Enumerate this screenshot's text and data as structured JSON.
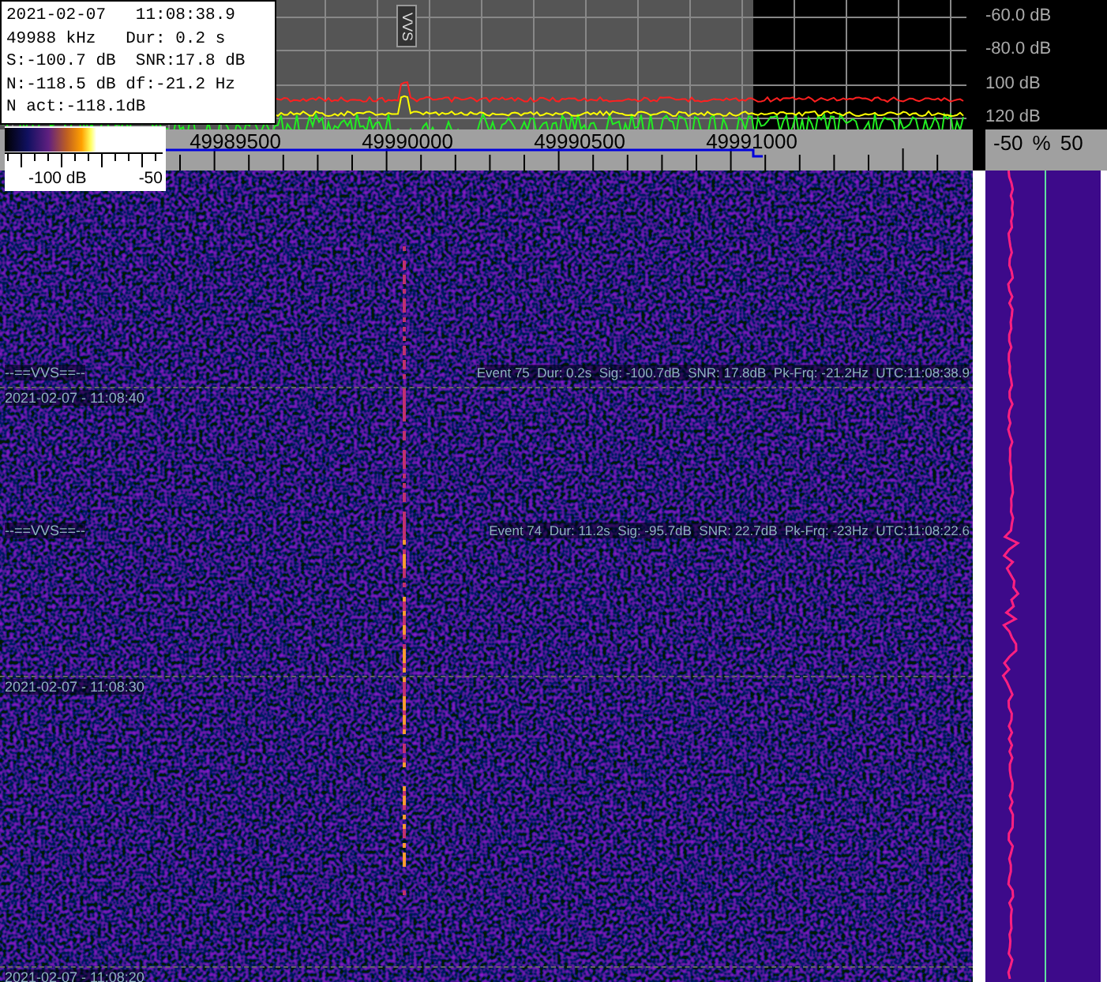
{
  "info_box": {
    "lines": [
      "2021-02-07   11:08:38.9",
      "49988 kHz   Dur: 0.2 s",
      "S:-100.7 dB  SNR:17.8 dB",
      "N:-118.5 dB df:-21.2 Hz",
      "N act:-118.1dB"
    ]
  },
  "spectrum": {
    "marker_label": "VVS",
    "db_labels": [
      "-60.0 dB",
      "-80.0 dB",
      "100 dB",
      "120 dB"
    ]
  },
  "color_scale": {
    "labels": [
      "-100 dB",
      "-50"
    ]
  },
  "frequency_axis": {
    "labels": [
      "49989500",
      "49990000",
      "49990500",
      "49991000"
    ]
  },
  "level_panel": {
    "labels": [
      "-50",
      "%",
      "50"
    ]
  },
  "waterfall": {
    "events": [
      {
        "label": "--==VVS==--",
        "text": "Event 75  Dur: 0.2s  Sig: -100.7dB  SNR: 17.8dB  Pk-Frq: -21.2Hz  UTC:11:08:38.9"
      },
      {
        "label": "--==VVS==--",
        "text": "Event 74  Dur: 11.2s  Sig: -95.7dB  SNR: 22.7dB  Pk-Frq: -23Hz  UTC:11:08:22.6"
      }
    ],
    "time_marks": [
      "2021-02-07 - 11:08:40",
      "2021-02-07 - 11:08:30",
      "2021-02-07 - 11:08:20"
    ]
  }
}
